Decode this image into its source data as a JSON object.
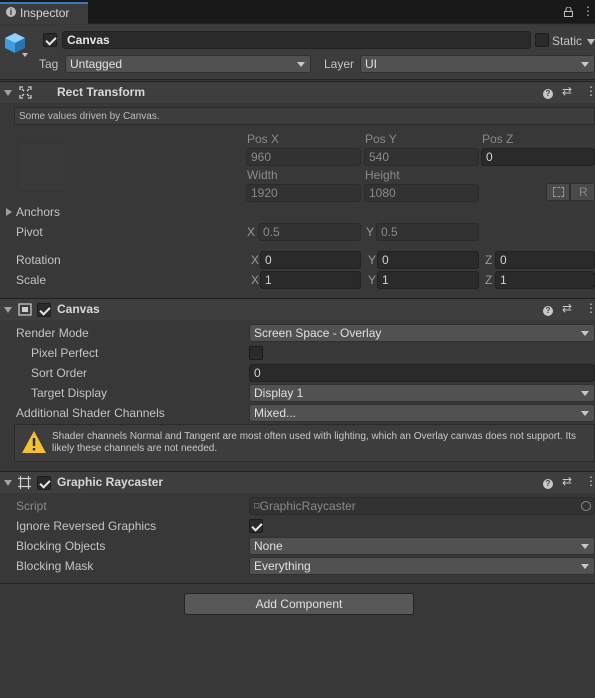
{
  "tab": {
    "title": "Inspector"
  },
  "object": {
    "name": "Canvas",
    "active": true,
    "static_label": "Static",
    "tag_label": "Tag",
    "tag_value": "Untagged",
    "layer_label": "Layer",
    "layer_value": "UI"
  },
  "rect_transform": {
    "title": "Rect Transform",
    "driven_note": "Some values driven by Canvas.",
    "pos_x_label": "Pos X",
    "pos_y_label": "Pos Y",
    "pos_z_label": "Pos Z",
    "pos_x": "960",
    "pos_y": "540",
    "pos_z": "0",
    "width_label": "Width",
    "height_label": "Height",
    "width": "1920",
    "height": "1080",
    "r_button": "R",
    "anchors_label": "Anchors",
    "pivot_label": "Pivot",
    "pivot_x": "0.5",
    "pivot_y": "0.5",
    "rotation_label": "Rotation",
    "rot_x": "0",
    "rot_y": "0",
    "rot_z": "0",
    "scale_label": "Scale",
    "scale_x": "1",
    "scale_y": "1",
    "scale_z": "1",
    "axis_x": "X",
    "axis_y": "Y",
    "axis_z": "Z"
  },
  "canvas": {
    "title": "Canvas",
    "enabled": true,
    "render_mode_label": "Render Mode",
    "render_mode": "Screen Space - Overlay",
    "pixel_perfect_label": "Pixel Perfect",
    "pixel_perfect": false,
    "sort_order_label": "Sort Order",
    "sort_order": "0",
    "target_display_label": "Target Display",
    "target_display": "Display 1",
    "shader_channels_label": "Additional Shader Channels",
    "shader_channels": "Mixed...",
    "warning": "Shader channels Normal and Tangent are most often used with lighting, which an Overlay canvas does not support. Its likely these channels are not needed."
  },
  "raycaster": {
    "title": "Graphic Raycaster",
    "enabled": true,
    "script_label": "Script",
    "script_value": "GraphicRaycaster",
    "ignore_reversed_label": "Ignore Reversed Graphics",
    "ignore_reversed": true,
    "blocking_objects_label": "Blocking Objects",
    "blocking_objects": "None",
    "blocking_mask_label": "Blocking Mask",
    "blocking_mask": "Everything"
  },
  "add_component": "Add Component",
  "colors": {
    "background": "#383838",
    "header": "#3e3e3e",
    "warning": "#f2c230",
    "cube": "#3d9be0"
  }
}
